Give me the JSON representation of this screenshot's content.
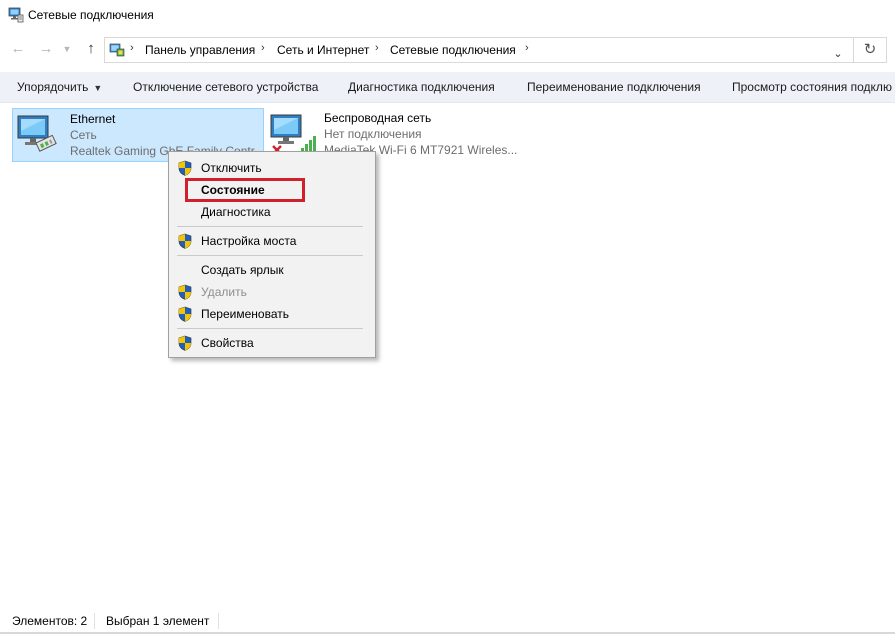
{
  "window": {
    "title": "Сетевые подключения",
    "icon": "network-connections-icon"
  },
  "nav": {
    "back_icon": "arrow-left-icon",
    "forward_icon": "arrow-right-icon",
    "recent_icon": "chevron-down-icon",
    "up_icon": "arrow-up-icon",
    "breadcrumbs": [
      "Панель управления",
      "Сеть и Интернет",
      "Сетевые подключения"
    ],
    "refresh_icon": "refresh-icon"
  },
  "commands": {
    "organize": "Упорядочить",
    "disable": "Отключение сетевого устройства",
    "diagnose": "Диагностика подключения",
    "rename": "Переименование подключения",
    "view_status": "Просмотр состояния подклю"
  },
  "connections": [
    {
      "name": "Ethernet",
      "status": "Сеть",
      "device": "Realtek Gaming GbE Family Contr",
      "selected": true
    },
    {
      "name": "Беспроводная сеть",
      "status": "Нет подключения",
      "device": "MediaTek Wi-Fi 6 MT7921 Wireles...",
      "selected": false
    }
  ],
  "context_menu": {
    "items": [
      {
        "label": "Отключить",
        "shield": true,
        "disabled": false,
        "bold": false
      },
      {
        "label": "Состояние",
        "shield": false,
        "disabled": false,
        "bold": true
      },
      {
        "label": "Диагностика",
        "shield": false,
        "disabled": false,
        "bold": false
      },
      {
        "label": "Настройка моста",
        "shield": true,
        "disabled": false,
        "bold": false
      },
      {
        "label": "Создать ярлык",
        "shield": false,
        "disabled": false,
        "bold": false
      },
      {
        "label": "Удалить",
        "shield": true,
        "disabled": true,
        "bold": false
      },
      {
        "label": "Переименовать",
        "shield": true,
        "disabled": false,
        "bold": false
      },
      {
        "label": "Свойства",
        "shield": true,
        "disabled": false,
        "bold": false
      }
    ],
    "highlight_color": "#d0202c"
  },
  "statusbar": {
    "count": "Элементов: 2",
    "selection": "Выбран 1 элемент"
  },
  "colors": {
    "selection_bg": "#cce8ff",
    "selection_border": "#99d1ff",
    "command_bar": "#eef2f8"
  }
}
